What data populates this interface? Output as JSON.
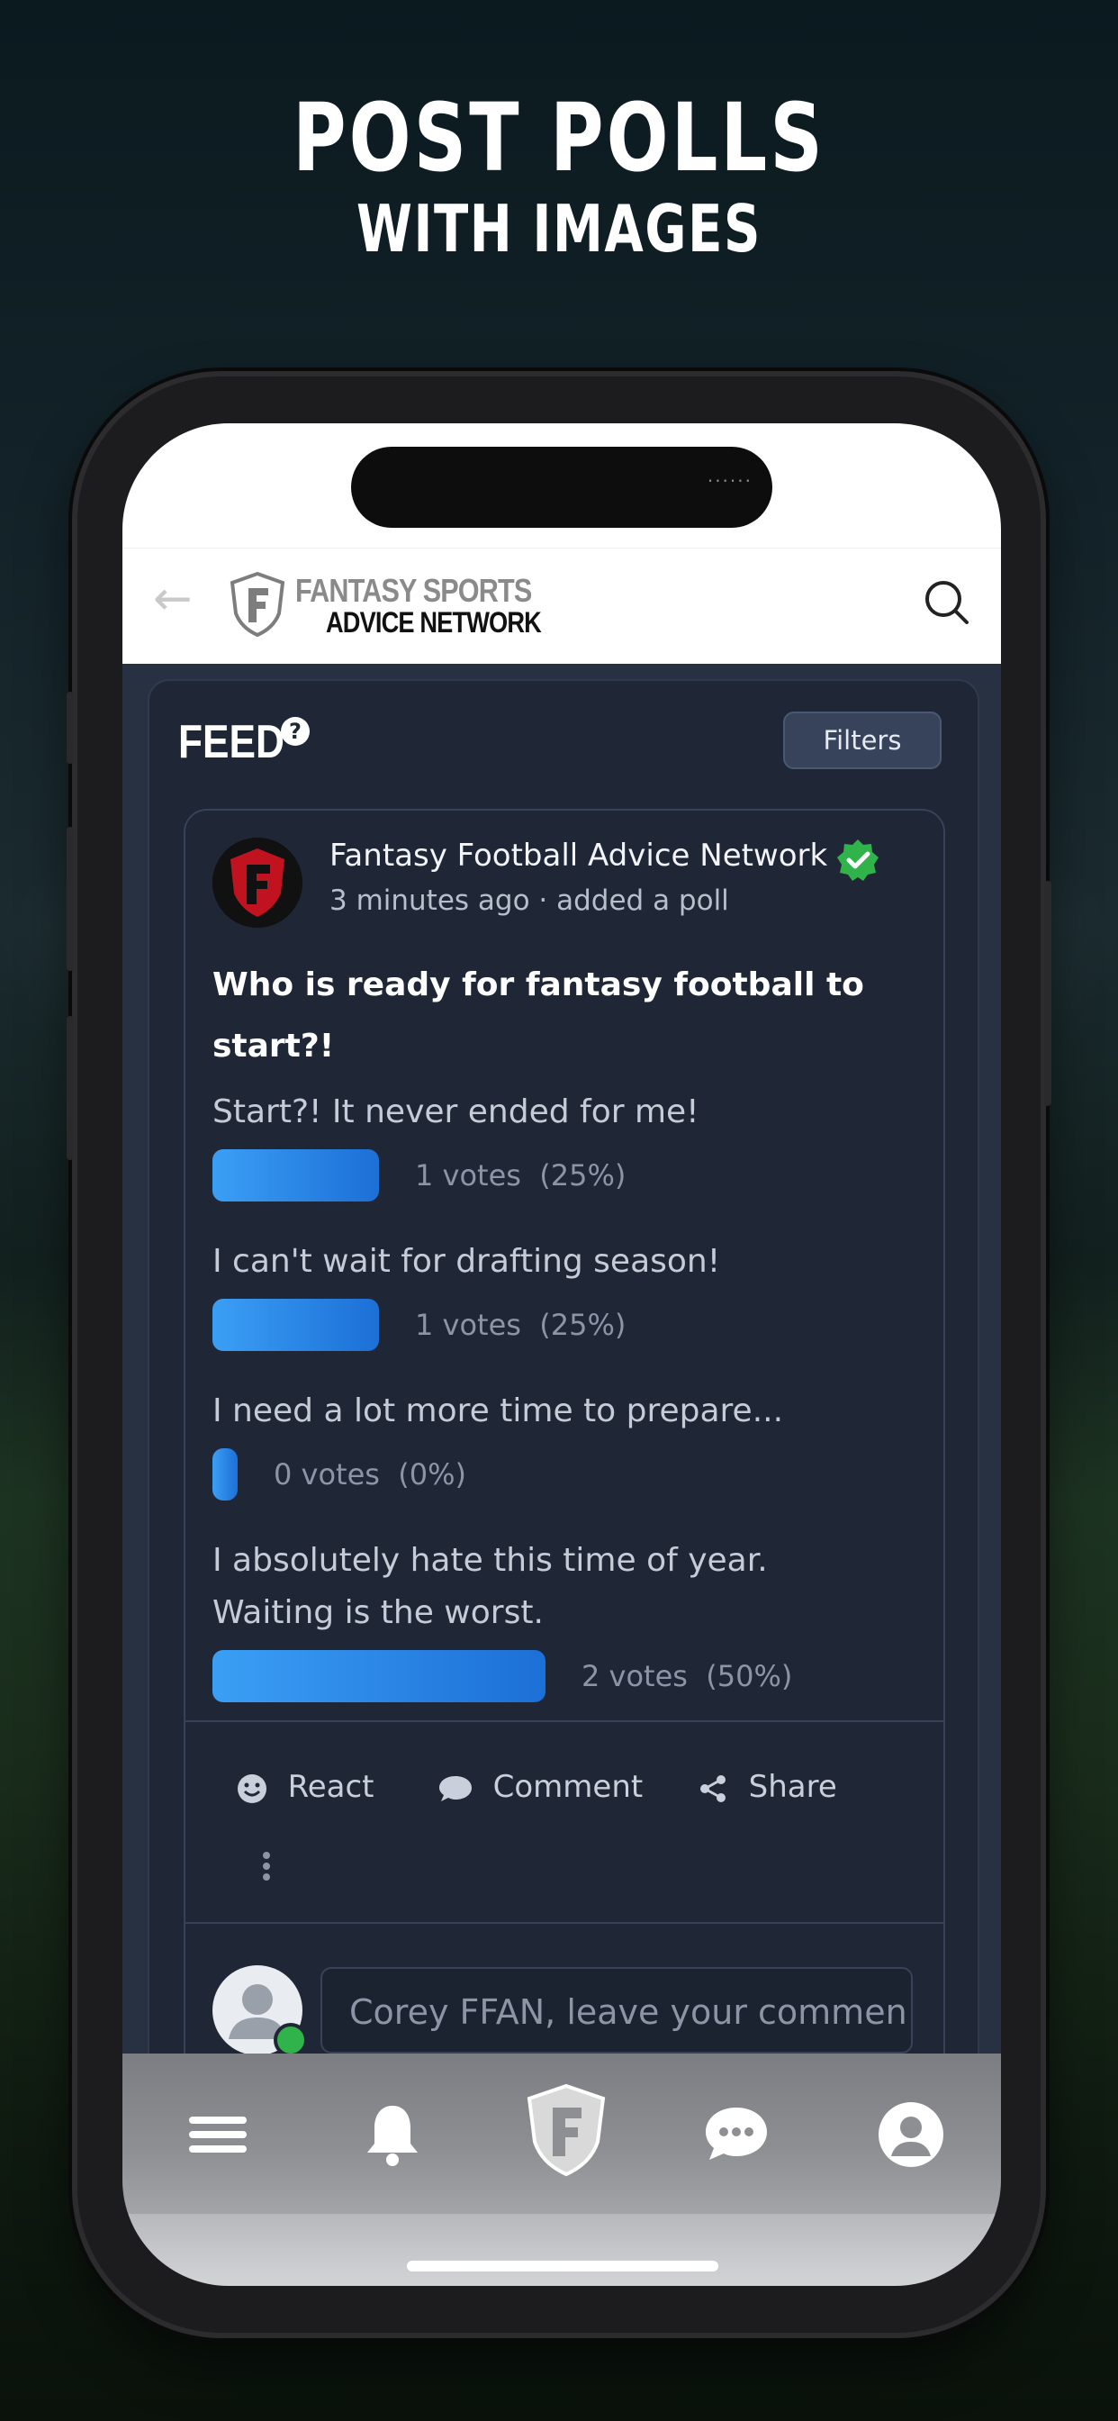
{
  "headline": {
    "line1": "POST POLLS",
    "line2": "WITH IMAGES"
  },
  "header": {
    "logo_line1": "FANTASY SPORTS",
    "logo_line2": "ADVICE NETWORK"
  },
  "feed": {
    "title": "FEED",
    "help_glyph": "?",
    "filters_label": "Filters"
  },
  "post": {
    "author": "Fantasy Football Advice Network",
    "meta": "3 minutes ago · added a poll",
    "question": "Who is ready for fantasy football to start?!",
    "options": [
      {
        "label": "Start?! It never ended for me!",
        "votes_text": "1 votes",
        "percent_text": "(25%)",
        "share": 0.25
      },
      {
        "label": "I can't wait for drafting season!",
        "votes_text": "1 votes",
        "percent_text": "(25%)",
        "share": 0.25
      },
      {
        "label": "I need a lot more time to prepare...",
        "votes_text": "0 votes",
        "percent_text": "(0%)",
        "share": 0.0
      },
      {
        "label": "I absolutely hate this time of year. Waiting is the worst.",
        "votes_text": "2 votes",
        "percent_text": "(50%)",
        "share": 0.5
      }
    ],
    "actions": {
      "react": "React",
      "comment": "Comment",
      "share": "Share"
    },
    "comment_placeholder": "Corey FFAN, leave your commen"
  },
  "tabbar": {
    "icons": [
      "menu-icon",
      "bell-icon",
      "ffan-logo-icon",
      "chat-icon",
      "profile-icon"
    ]
  },
  "colors": {
    "accent_blue": "#1c6fd6",
    "verified_green": "#2fb34a",
    "card_bg": "#1f2736"
  }
}
